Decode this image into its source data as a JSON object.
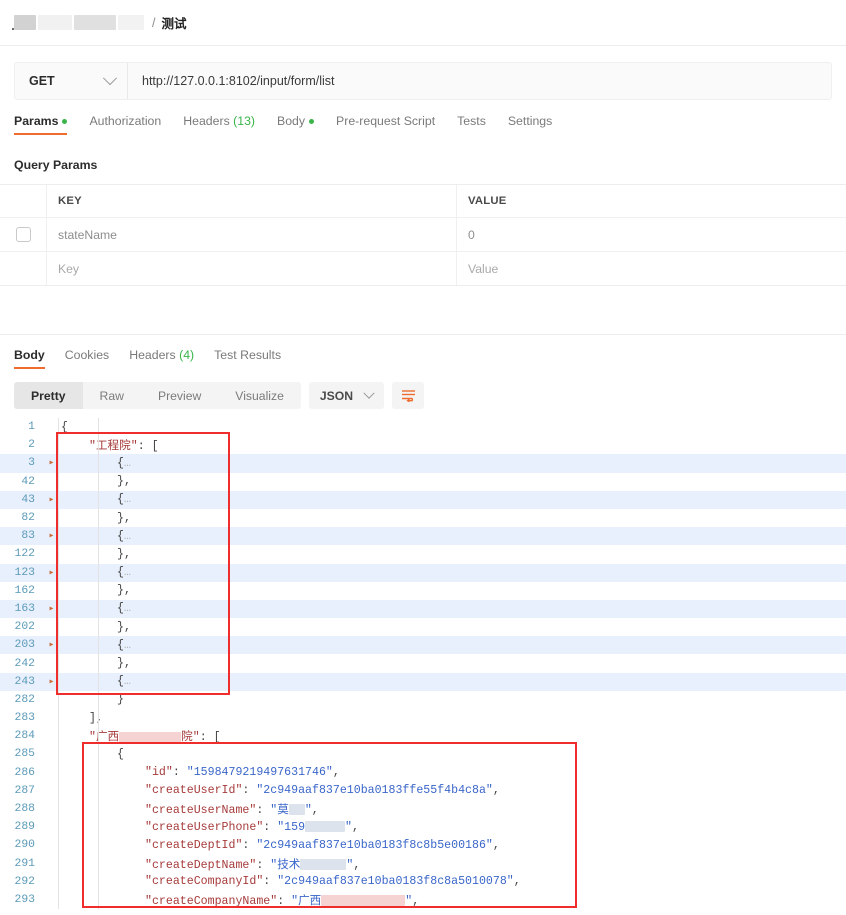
{
  "breadcrumb": {
    "separator": "/",
    "current": "测试",
    "redacted_segments": 4
  },
  "request": {
    "method": "GET",
    "method_caret_icon": "chevron-down-icon",
    "url": "http://127.0.0.1:8102/input/form/list",
    "tabs": [
      {
        "label": "Params",
        "dot": true,
        "active": true
      },
      {
        "label": "Authorization",
        "dot": false,
        "active": false
      },
      {
        "label": "Headers",
        "count": "(13)",
        "dot": false,
        "active": false
      },
      {
        "label": "Body",
        "dot": true,
        "active": false
      },
      {
        "label": "Pre-request Script",
        "dot": false,
        "active": false
      },
      {
        "label": "Tests",
        "dot": false,
        "active": false
      },
      {
        "label": "Settings",
        "dot": false,
        "active": false
      }
    ],
    "section_title": "Query Params",
    "table": {
      "columns": [
        "KEY",
        "VALUE"
      ],
      "rows": [
        {
          "checked": false,
          "key": "stateName",
          "value": "0",
          "placeholder": false
        },
        {
          "checked": null,
          "key": "Key",
          "value": "Value",
          "placeholder": true
        }
      ]
    }
  },
  "response": {
    "tabs": [
      {
        "label": "Body",
        "active": true
      },
      {
        "label": "Cookies",
        "active": false
      },
      {
        "label": "Headers",
        "count": "(4)",
        "active": false
      },
      {
        "label": "Test Results",
        "active": false
      }
    ],
    "view_modes": [
      "Pretty",
      "Raw",
      "Preview",
      "Visualize"
    ],
    "active_view_mode": "Pretty",
    "format": "JSON",
    "format_caret_icon": "chevron-down-icon",
    "wrap_button_icon": "wrap-text-icon",
    "wrap_icon_color": "#ef6c2e"
  },
  "colors": {
    "accent": "#ef6c2e",
    "green": "#3bb54a",
    "annotation_red": "#ef2d2d",
    "zebra_row": "#e8f0fd",
    "line_number": "#5b9ab8",
    "json_key": "#a63a3a",
    "json_string": "#3a66c9"
  },
  "json_lines": [
    {
      "no": "1",
      "fold": "",
      "zebra": false,
      "indent": 0,
      "segments": [
        {
          "t": "p",
          "v": "{"
        }
      ]
    },
    {
      "no": "2",
      "fold": "",
      "zebra": false,
      "indent": 1,
      "segments": [
        {
          "t": "k",
          "v": "\"工程院\""
        },
        {
          "t": "p",
          "v": ": ["
        }
      ]
    },
    {
      "no": "3",
      "fold": "▸",
      "zebra": true,
      "indent": 2,
      "segments": [
        {
          "t": "p",
          "v": "{"
        },
        {
          "t": "e",
          "v": "…"
        }
      ]
    },
    {
      "no": "42",
      "fold": "",
      "zebra": false,
      "indent": 2,
      "segments": [
        {
          "t": "p",
          "v": "},"
        }
      ]
    },
    {
      "no": "43",
      "fold": "▸",
      "zebra": true,
      "indent": 2,
      "segments": [
        {
          "t": "p",
          "v": "{"
        },
        {
          "t": "e",
          "v": "…"
        }
      ]
    },
    {
      "no": "82",
      "fold": "",
      "zebra": false,
      "indent": 2,
      "segments": [
        {
          "t": "p",
          "v": "},"
        }
      ]
    },
    {
      "no": "83",
      "fold": "▸",
      "zebra": true,
      "indent": 2,
      "segments": [
        {
          "t": "p",
          "v": "{"
        },
        {
          "t": "e",
          "v": "…"
        }
      ]
    },
    {
      "no": "122",
      "fold": "",
      "zebra": false,
      "indent": 2,
      "segments": [
        {
          "t": "p",
          "v": "},"
        }
      ]
    },
    {
      "no": "123",
      "fold": "▸",
      "zebra": true,
      "indent": 2,
      "segments": [
        {
          "t": "p",
          "v": "{"
        },
        {
          "t": "e",
          "v": "…"
        }
      ]
    },
    {
      "no": "162",
      "fold": "",
      "zebra": false,
      "indent": 2,
      "segments": [
        {
          "t": "p",
          "v": "},"
        }
      ]
    },
    {
      "no": "163",
      "fold": "▸",
      "zebra": true,
      "indent": 2,
      "segments": [
        {
          "t": "p",
          "v": "{"
        },
        {
          "t": "e",
          "v": "…"
        }
      ]
    },
    {
      "no": "202",
      "fold": "",
      "zebra": false,
      "indent": 2,
      "segments": [
        {
          "t": "p",
          "v": "},"
        }
      ]
    },
    {
      "no": "203",
      "fold": "▸",
      "zebra": true,
      "indent": 2,
      "segments": [
        {
          "t": "p",
          "v": "{"
        },
        {
          "t": "e",
          "v": "…"
        }
      ]
    },
    {
      "no": "242",
      "fold": "",
      "zebra": false,
      "indent": 2,
      "segments": [
        {
          "t": "p",
          "v": "},"
        }
      ]
    },
    {
      "no": "243",
      "fold": "▸",
      "zebra": true,
      "indent": 2,
      "segments": [
        {
          "t": "p",
          "v": "{"
        },
        {
          "t": "e",
          "v": "…"
        }
      ]
    },
    {
      "no": "282",
      "fold": "",
      "zebra": false,
      "indent": 2,
      "segments": [
        {
          "t": "p",
          "v": "}"
        }
      ]
    },
    {
      "no": "283",
      "fold": "",
      "zebra": false,
      "indent": 1,
      "segments": [
        {
          "t": "p",
          "v": "],"
        }
      ]
    },
    {
      "no": "284",
      "fold": "",
      "zebra": false,
      "indent": 1,
      "segments": [
        {
          "t": "k",
          "v": "\"广西"
        },
        {
          "t": "rd-p",
          "v": "62"
        },
        {
          "t": "k",
          "v": "院\""
        },
        {
          "t": "p",
          "v": ": ["
        }
      ]
    },
    {
      "no": "285",
      "fold": "",
      "zebra": false,
      "indent": 2,
      "segments": [
        {
          "t": "p",
          "v": "{"
        }
      ]
    },
    {
      "no": "286",
      "fold": "",
      "zebra": false,
      "indent": 3,
      "segments": [
        {
          "t": "k",
          "v": "\"id\""
        },
        {
          "t": "p",
          "v": ": "
        },
        {
          "t": "s",
          "v": "\"1598479219497631746\""
        },
        {
          "t": "p",
          "v": ","
        }
      ]
    },
    {
      "no": "287",
      "fold": "",
      "zebra": false,
      "indent": 3,
      "segments": [
        {
          "t": "k",
          "v": "\"createUserId\""
        },
        {
          "t": "p",
          "v": ": "
        },
        {
          "t": "s",
          "v": "\"2c949aaf837e10ba0183ffe55f4b4c8a\""
        },
        {
          "t": "p",
          "v": ","
        }
      ]
    },
    {
      "no": "288",
      "fold": "",
      "zebra": false,
      "indent": 3,
      "segments": [
        {
          "t": "k",
          "v": "\"createUserName\""
        },
        {
          "t": "p",
          "v": ": "
        },
        {
          "t": "s",
          "v": "\"莫"
        },
        {
          "t": "rd-b",
          "v": "16"
        },
        {
          "t": "s",
          "v": "\""
        },
        {
          "t": "p",
          "v": ","
        }
      ]
    },
    {
      "no": "289",
      "fold": "",
      "zebra": false,
      "indent": 3,
      "segments": [
        {
          "t": "k",
          "v": "\"createUserPhone\""
        },
        {
          "t": "p",
          "v": ": "
        },
        {
          "t": "s",
          "v": "\"159"
        },
        {
          "t": "rd-b",
          "v": "40"
        },
        {
          "t": "s",
          "v": "\""
        },
        {
          "t": "p",
          "v": ","
        }
      ]
    },
    {
      "no": "290",
      "fold": "",
      "zebra": false,
      "indent": 3,
      "segments": [
        {
          "t": "k",
          "v": "\"createDeptId\""
        },
        {
          "t": "p",
          "v": ": "
        },
        {
          "t": "s",
          "v": "\"2c949aaf837e10ba0183f8c8b5e00186\""
        },
        {
          "t": "p",
          "v": ","
        }
      ]
    },
    {
      "no": "291",
      "fold": "",
      "zebra": false,
      "indent": 3,
      "segments": [
        {
          "t": "k",
          "v": "\"createDeptName\""
        },
        {
          "t": "p",
          "v": ": "
        },
        {
          "t": "s",
          "v": "\"技术"
        },
        {
          "t": "rd-b",
          "v": "46"
        },
        {
          "t": "s",
          "v": "\""
        },
        {
          "t": "p",
          "v": ","
        }
      ]
    },
    {
      "no": "292",
      "fold": "",
      "zebra": false,
      "indent": 3,
      "segments": [
        {
          "t": "k",
          "v": "\"createCompanyId\""
        },
        {
          "t": "p",
          "v": ": "
        },
        {
          "t": "s",
          "v": "\"2c949aaf837e10ba0183f8c8a5010078\""
        },
        {
          "t": "p",
          "v": ","
        }
      ]
    },
    {
      "no": "293",
      "fold": "",
      "zebra": false,
      "indent": 3,
      "segments": [
        {
          "t": "k",
          "v": "\"createCompanyName\""
        },
        {
          "t": "p",
          "v": ": "
        },
        {
          "t": "s",
          "v": "\"广西"
        },
        {
          "t": "rd-p",
          "v": "84"
        },
        {
          "t": "s",
          "v": "\""
        },
        {
          "t": "p",
          "v": ","
        }
      ]
    }
  ]
}
